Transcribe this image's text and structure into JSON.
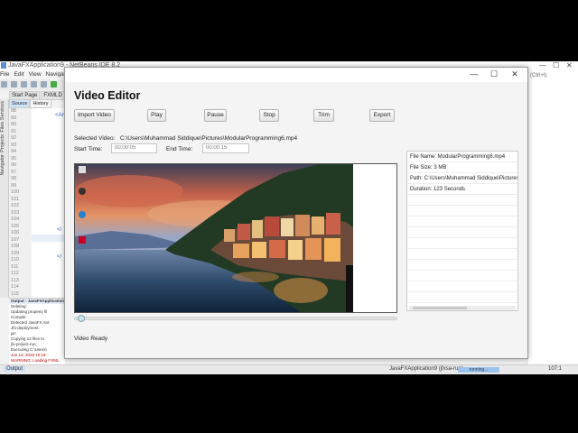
{
  "ide": {
    "title": "JavaFXApplication9 - NetBeans IDE 8.2",
    "menu": [
      "File",
      "Edit",
      "View",
      "Navigate"
    ],
    "tabs": [
      "Start Page",
      "FXMLD"
    ],
    "source_tabs": [
      "Source",
      "History"
    ],
    "sidebar_items": [
      "Services",
      "Files",
      "Projects",
      "Navigator"
    ],
    "line_numbers": [
      "88",
      "89",
      "90",
      "91",
      "92",
      "93",
      "94",
      "95",
      "96",
      "97",
      "98",
      "99",
      "100",
      "101",
      "102",
      "103",
      "104",
      "105",
      "106",
      "107",
      "108",
      "109",
      "110",
      "111",
      "112",
      "113",
      "114",
      "115"
    ],
    "right_shortcut": "(Ctrl+I)",
    "output_title": "Output - JavaFXApplication9 (jfx",
    "output_lines": [
      {
        "text": "Deleting:",
        "red": false
      },
      {
        "text": "Updating property fil",
        "red": false
      },
      {
        "text": "Compile",
        "red": false
      },
      {
        "text": "Detected JavaFX Ant",
        "red": false
      },
      {
        "text": "Jfx-deployment:",
        "red": false
      },
      {
        "text": "jar:",
        "red": false
      },
      {
        "text": "Copying 12 files to",
        "red": false
      },
      {
        "text": "jfx-project-run:",
        "red": false
      },
      {
        "text": "Executing C:\\Users\\",
        "red": false
      },
      {
        "text": "Jun 13, 2018 10:16:",
        "red": true
      },
      {
        "text": "WARNING: Loading FXML",
        "red": true
      }
    ],
    "status_output": "Output",
    "status_run": "JavaFXApplication9 (jfxsa-run)",
    "status_progress": "running...",
    "status_pos": "107:1"
  },
  "editor": {
    "title": "Video Editor",
    "buttons": {
      "import": "Import Video",
      "play": "Play",
      "pause": "Pause",
      "stop": "Stop",
      "trim": "Trim",
      "export": "Export"
    },
    "selected_label": "Selected Video:",
    "selected_path": "C:\\Users\\Muhammad Siddique\\Pictures\\ModularProgramming6.mp4",
    "start_label": "Start Time:",
    "start_placeholder": "00:00:05",
    "end_label": "End Time:",
    "end_placeholder": "00:00:15",
    "info": {
      "name": "File Name: ModularProgramming6.mp4",
      "size": "File Size: 3 MB",
      "path": "Path: C:\\Users\\Muhammad Siddique\\Pictures\\ModularProgramming6.mp4",
      "duration": "Duration: 123 Seconds"
    },
    "status": "Video Ready",
    "window_controls": {
      "minimize": "—",
      "maximize": "☐",
      "close": "✕"
    }
  },
  "colors": {
    "accent": "#9cc3ec"
  }
}
